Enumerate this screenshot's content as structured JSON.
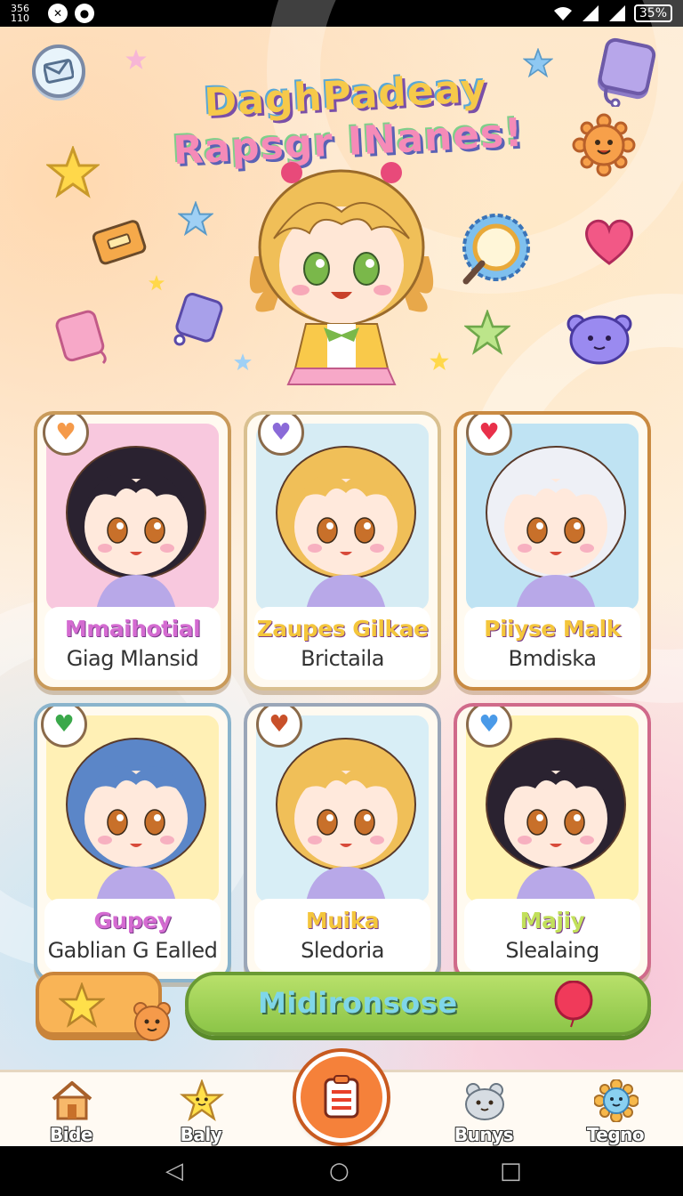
{
  "status_bar": {
    "time": "356\n110",
    "battery": "35%"
  },
  "header": {
    "title_line1": "DaghPadeay",
    "title_line2": "Rapsgr INanes!"
  },
  "cards": [
    {
      "name": "Mmaihotial",
      "subtitle": "Giag Mlansid",
      "name_color": "#d46bd1",
      "border": "#c99a5a",
      "art_bg": "#f8c8de",
      "hair": "#2a2230",
      "badge_icon": "smile-face-icon"
    },
    {
      "name": "Zaupes Gilkae",
      "subtitle": "Brictaila",
      "name_color": "#f4c63c",
      "border": "#d9c090",
      "art_bg": "#d6ecf4",
      "hair": "#f0bf58",
      "badge_icon": "purple-heart-icon"
    },
    {
      "name": "Piiyse Malk",
      "subtitle": "Bmdiska",
      "name_color": "#f4c63c",
      "border": "#c98a42",
      "art_bg": "#bfe3f3",
      "hair": "#eef0f6",
      "badge_icon": "red-heart-icon"
    },
    {
      "name": "Gupey",
      "subtitle": "Gablian G Ealled",
      "name_color": "#d46bd1",
      "border": "#8ab4cc",
      "art_bg": "#fff0b5",
      "hair": "#5b86c8",
      "badge_icon": "green-badge-icon"
    },
    {
      "name": "Muika",
      "subtitle": "Sledoria",
      "name_color": "#f4c63c",
      "border": "#9aa6b8",
      "art_bg": "#d8eef6",
      "hair": "#f0bf58",
      "badge_icon": "fox-mask-icon"
    },
    {
      "name": "Majiy",
      "subtitle": "Slealaing",
      "name_color": "#c2e05a",
      "border": "#d06a8a",
      "art_bg": "#fff2b0",
      "hair": "#2a2230",
      "badge_icon": "blue-bunny-icon"
    }
  ],
  "actions": {
    "main_button_label": "Midironsose"
  },
  "bottom_nav": [
    {
      "label": "Bide",
      "icon": "house-icon"
    },
    {
      "label": "Baly",
      "icon": "smiling-star-icon"
    },
    {
      "label": "Bunys",
      "icon": "bunny-face-icon"
    },
    {
      "label": "Tegno",
      "icon": "flower-face-icon"
    }
  ],
  "colors": {
    "accent_orange": "#f5813a",
    "accent_green": "#8cc548",
    "title_yellow": "#f6c94a",
    "title_pink": "#f58bb8"
  }
}
